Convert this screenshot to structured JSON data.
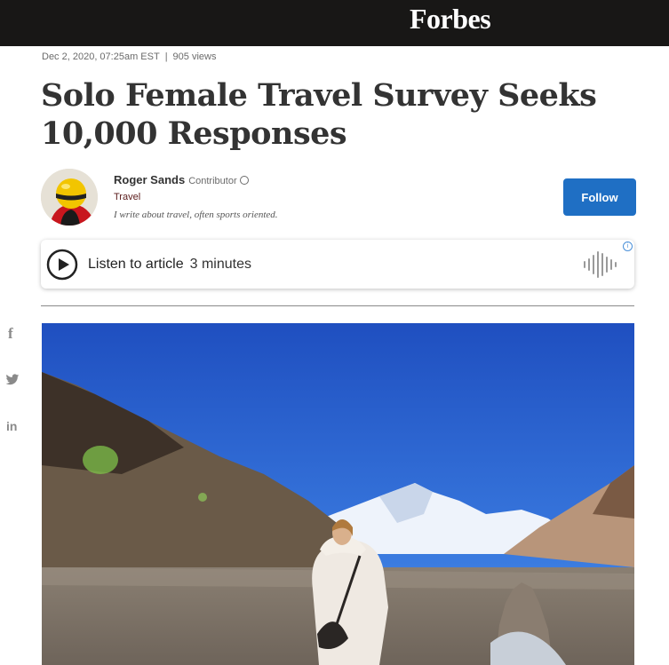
{
  "header": {
    "logo": "Forbes"
  },
  "article": {
    "date": "Dec 2, 2020, 07:25am EST",
    "separator": "|",
    "views": "905 views",
    "title": "Solo Female Travel Survey Seeks 10,000 Responses"
  },
  "author": {
    "name": "Roger Sands",
    "role": "Contributor",
    "section": "Travel",
    "bio": "I write about travel, often sports oriented.",
    "follow_label": "Follow"
  },
  "audio": {
    "label": "Listen to article",
    "duration": "3 minutes",
    "info_glyph": "i"
  },
  "share": {
    "icons": [
      "facebook-icon",
      "twitter-icon",
      "linkedin-icon"
    ],
    "facebook_glyph": "f",
    "linkedin_glyph": "in"
  },
  "colors": {
    "topbar": "#181716",
    "follow": "#1f6fc4",
    "section": "#5a1a1a"
  }
}
